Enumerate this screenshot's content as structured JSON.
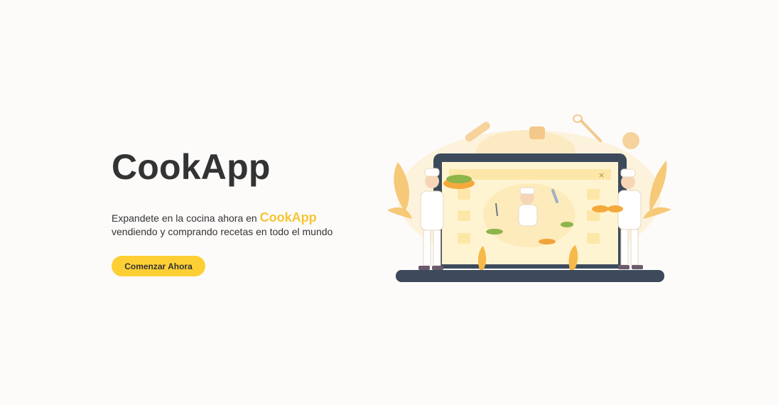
{
  "hero": {
    "title": "CookApp",
    "description_before": "Expandete en la cocina ahora en ",
    "brand": "CookApp",
    "description_after": "vendiendo y comprando recetas en todo el mundo",
    "cta_label": "Comenzar Ahora"
  },
  "illustration": {
    "subject": "chefs-laptop-illustration",
    "window_close_glyph": "×"
  },
  "colors": {
    "background": "#fdfbfa",
    "accent": "#fdcf34",
    "brand_text": "#f6c531",
    "text": "#333333",
    "laptop": "#3c4a5c"
  }
}
